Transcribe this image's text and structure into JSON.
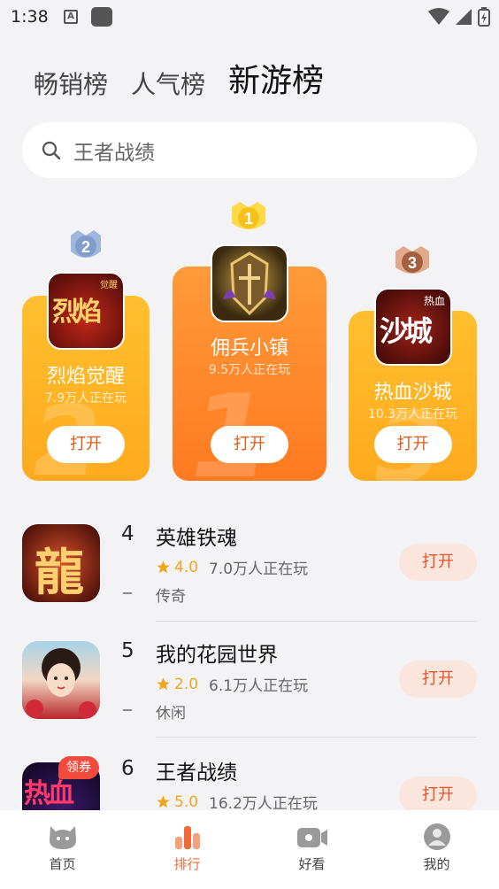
{
  "status_bar": {
    "time": "1:38",
    "a_icon": "A"
  },
  "tabs": [
    {
      "label": "畅销榜",
      "active": false
    },
    {
      "label": "人气榜",
      "active": false
    },
    {
      "label": "新游榜",
      "active": true
    }
  ],
  "search": {
    "placeholder": "王者战绩",
    "icon": "search-icon"
  },
  "podium": {
    "first": {
      "rank": "1",
      "name": "佣兵小镇",
      "players": "9.5万人正在玩",
      "button": "打开"
    },
    "second": {
      "rank": "2",
      "name": "烈焰觉醒",
      "players": "7.9万人正在玩",
      "button": "打开",
      "icon_text": "烈焰",
      "icon_subtext": "觉醒"
    },
    "third": {
      "rank": "3",
      "name": "热血沙城",
      "players": "10.3万人正在玩",
      "button": "打开",
      "icon_text": "沙城",
      "icon_subtext": "热血"
    }
  },
  "list": [
    {
      "rank": "4",
      "name": "英雄铁魂",
      "score": "4.0",
      "players": "7.0万人正在玩",
      "tag": "传奇",
      "button": "打开",
      "icon_text": "龍"
    },
    {
      "rank": "5",
      "name": "我的花园世界",
      "score": "2.0",
      "players": "6.1万人正在玩",
      "tag": "休闲",
      "button": "打开"
    },
    {
      "rank": "6",
      "name": "王者战绩",
      "score": "5.0",
      "players": "16.2万人正在玩",
      "button": "打开",
      "coupon": "领券",
      "icon_text": "热血"
    }
  ],
  "bottom_nav": [
    {
      "label": "首页",
      "icon": "home-cat-icon",
      "active": false
    },
    {
      "label": "排行",
      "icon": "ranking-bars-icon",
      "active": true
    },
    {
      "label": "好看",
      "icon": "video-camera-icon",
      "active": false
    },
    {
      "label": "我的",
      "icon": "user-avatar-icon",
      "active": false
    }
  ],
  "colors": {
    "accent": "#f26a3a",
    "podium_orange": "#ff8a2a",
    "podium_yellow": "#ffb52b",
    "star": "#f2a41c"
  }
}
